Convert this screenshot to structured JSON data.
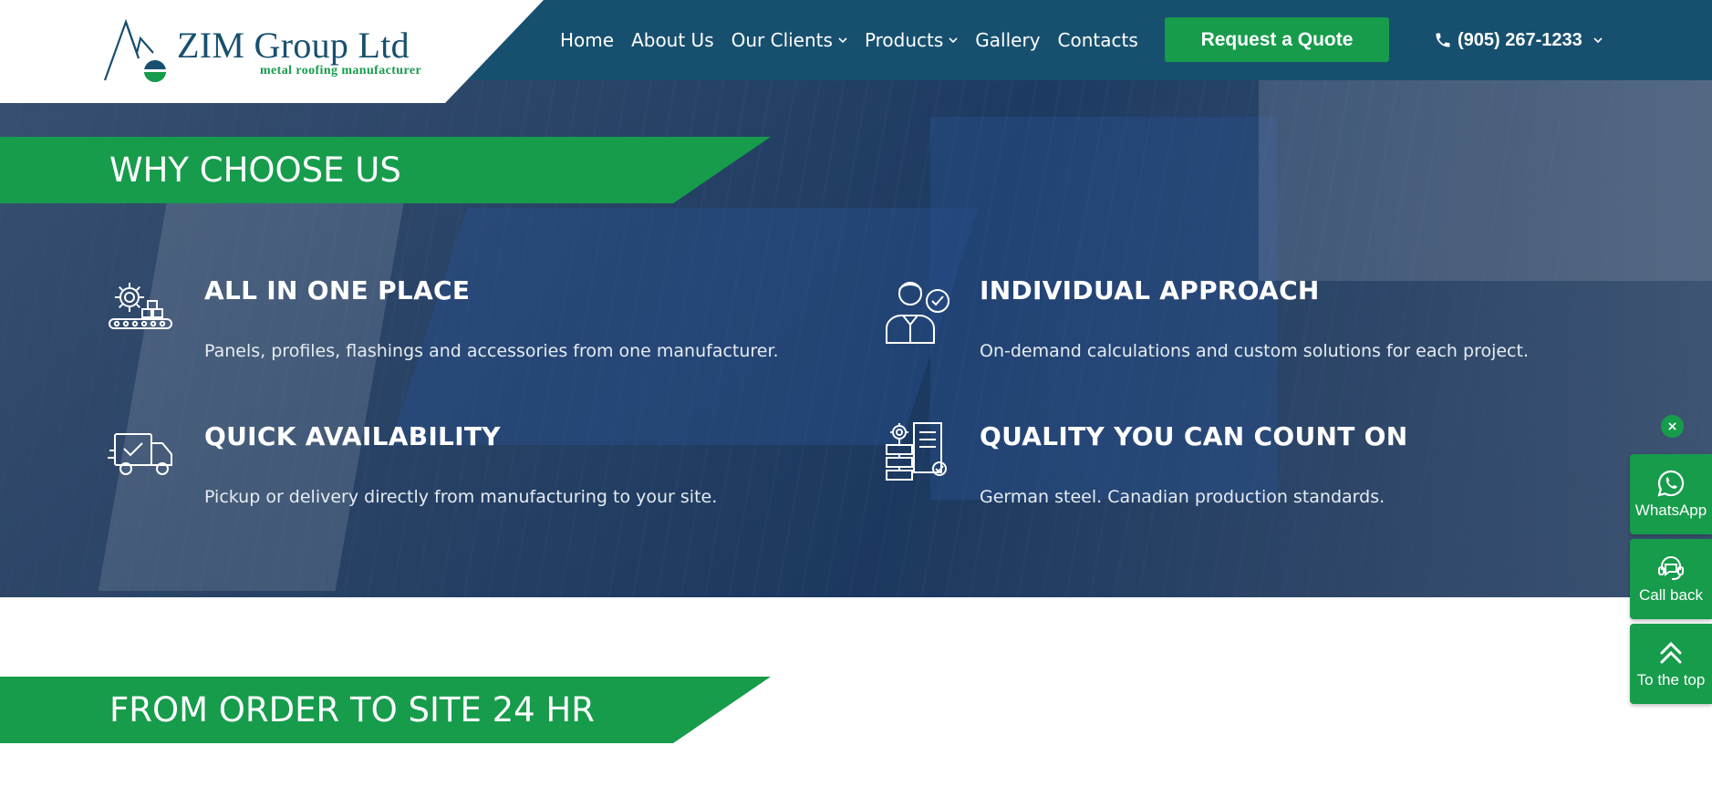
{
  "brand": {
    "name": "ZIM Group Ltd",
    "tagline": "metal roofing manufacturer"
  },
  "nav": {
    "items": [
      {
        "label": "Home",
        "has_dropdown": false
      },
      {
        "label": "About Us",
        "has_dropdown": false
      },
      {
        "label": "Our Clients",
        "has_dropdown": true
      },
      {
        "label": "Products",
        "has_dropdown": true
      },
      {
        "label": "Gallery",
        "has_dropdown": false
      },
      {
        "label": "Contacts",
        "has_dropdown": false
      }
    ],
    "quote_label": "Request a Quote",
    "phone": "(905) 267-1233"
  },
  "why": {
    "heading": "WHY CHOOSE US",
    "features": [
      {
        "title": "ALL IN ONE PLACE",
        "desc": "Panels, profiles, flashings and accessories from one manufacturer.",
        "icon": "conveyor-gear-icon"
      },
      {
        "title": "INDIVIDUAL APPROACH",
        "desc": "On-demand calculations and custom solutions for each project.",
        "icon": "person-check-icon"
      },
      {
        "title": "QUICK AVAILABILITY",
        "desc": "Pickup or delivery directly from manufacturing to your site.",
        "icon": "delivery-truck-icon"
      },
      {
        "title": "QUALITY YOU CAN COUNT ON",
        "desc": "German steel. Canadian production standards.",
        "icon": "quality-document-icon"
      }
    ]
  },
  "order": {
    "heading": "FROM ORDER TO SITE 24 HR"
  },
  "side": {
    "close": "×",
    "whatsapp": "WhatsApp",
    "callback": "Call back",
    "top": "To the top"
  },
  "colors": {
    "header_bg": "#17506f",
    "accent_green": "#169c4b",
    "hero_overlay": "#163054",
    "white": "#ffffff"
  }
}
